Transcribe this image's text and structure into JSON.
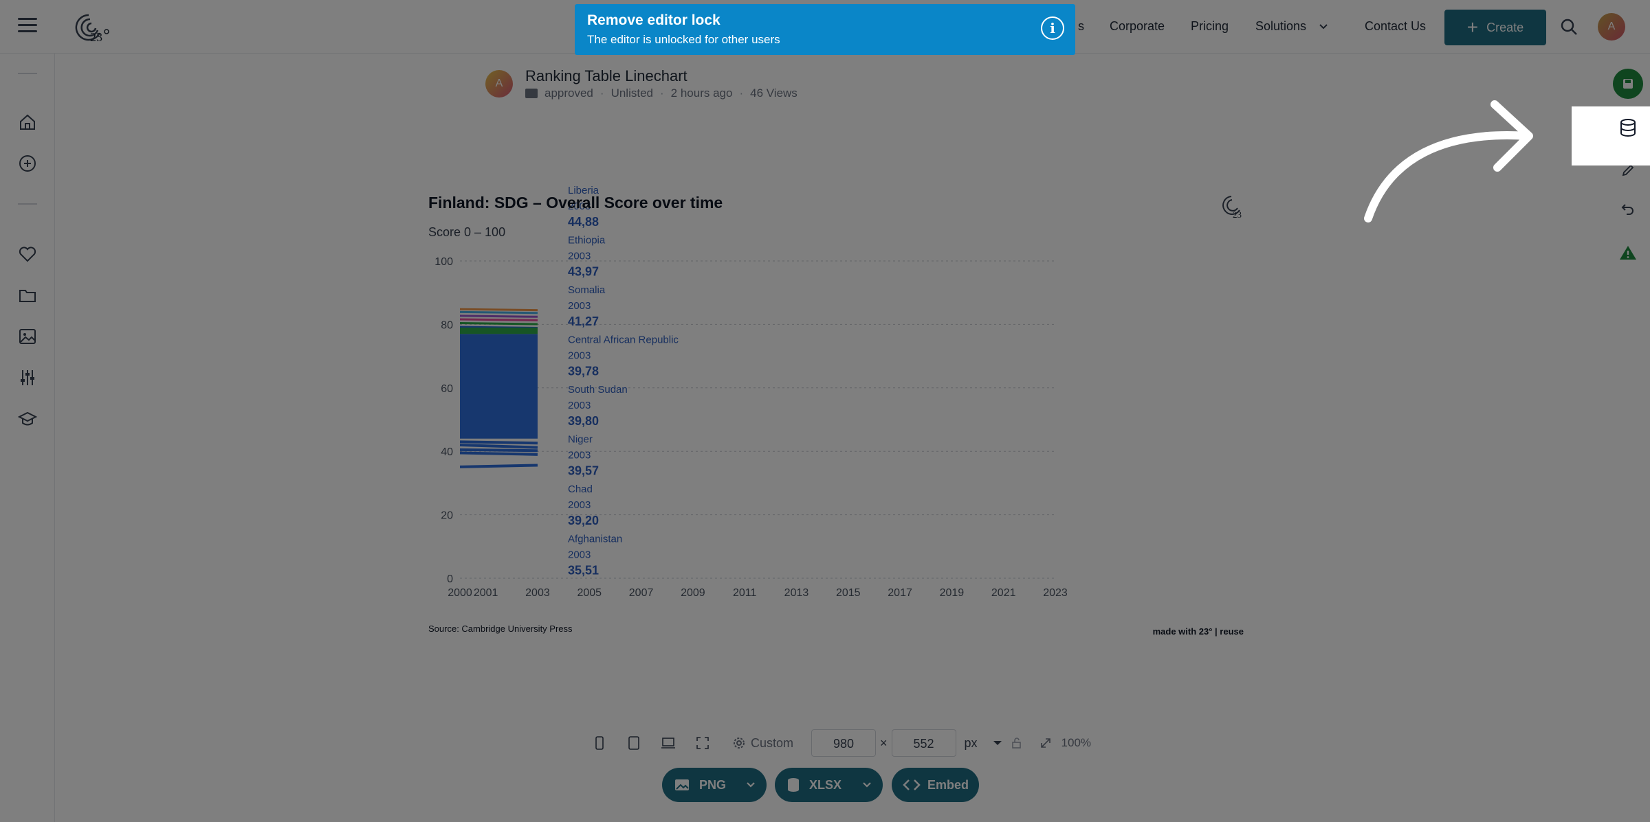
{
  "nav": {
    "partial_link": "s",
    "links": [
      "Corporate",
      "Pricing",
      "Solutions",
      "Contact Us"
    ],
    "create_label": "Create",
    "avatar_initial": "A"
  },
  "document": {
    "avatar_initial": "A",
    "title": "Ranking Table Linechart",
    "folder": "approved",
    "visibility": "Unlisted",
    "time": "2 hours ago",
    "views": "46 Views"
  },
  "chart_data": {
    "type": "line",
    "title": "Finland: SDG – Overall Score over time",
    "subtitle": "Score 0 – 100",
    "ylim": [
      0,
      100
    ],
    "y_ticks": [
      "100",
      "80",
      "60",
      "40",
      "20",
      "0"
    ],
    "x_ticks": [
      "2000",
      "2001",
      "2003",
      "2005",
      "2007",
      "2009",
      "2011",
      "2013",
      "2015",
      "2017",
      "2019",
      "2021",
      "2023"
    ],
    "labels": [
      {
        "country": "Liberia",
        "year": "2003",
        "value": "44,88"
      },
      {
        "country": "Ethiopia",
        "year": "2003",
        "value": "43,97"
      },
      {
        "country": "Somalia",
        "year": "2003",
        "value": "41,27"
      },
      {
        "country": "Central African Republic",
        "year": "2003",
        "value": "39,78"
      },
      {
        "country": "South Sudan",
        "year": "2003",
        "value": "39,80"
      },
      {
        "country": "Niger",
        "year": "2003",
        "value": "39,57"
      },
      {
        "country": "Chad",
        "year": "2003",
        "value": "39,20"
      },
      {
        "country": "Afghanistan",
        "year": "2003",
        "value": "35,51"
      }
    ],
    "series_colors": [
      "#f2994a",
      "#4ab0e8",
      "#9b59d0",
      "#e74c9c",
      "#2faa4a",
      "#2f6fdc"
    ],
    "source": "Source: Cambridge University Press",
    "made_with": "made with 23° | reuse"
  },
  "toolbar": {
    "preset": "Custom",
    "width": "980",
    "times": "×",
    "height": "552",
    "unit": "px",
    "zoom": "100%",
    "png": "PNG",
    "xlsx": "XLSX",
    "embed": "Embed"
  },
  "toast": {
    "title": "Remove editor lock",
    "message": "The editor is unlocked for other users",
    "info_glyph": "i"
  },
  "colors": {
    "primary": "#1f6c82",
    "toast": "#0a86c8",
    "series_blue": "#2f6fdc",
    "rail_green": "#1e8a3e"
  }
}
